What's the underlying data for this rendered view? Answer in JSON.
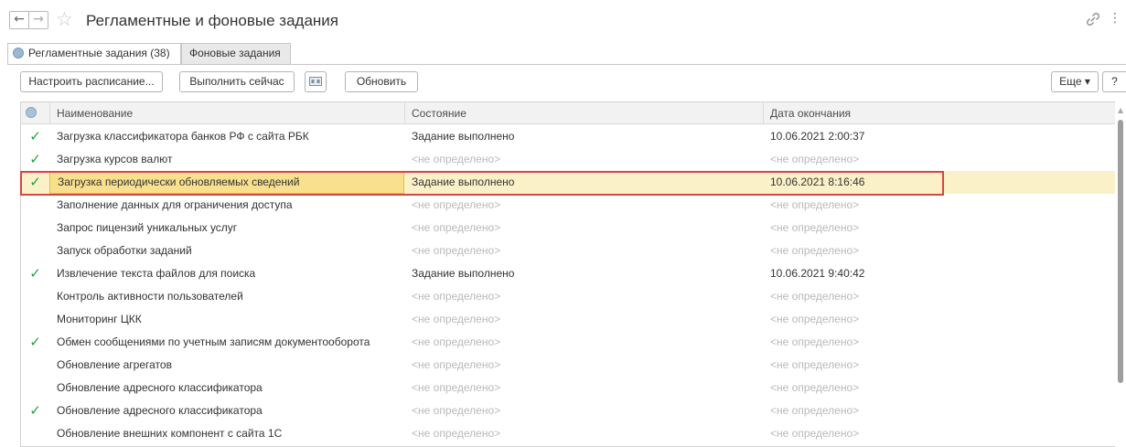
{
  "window": {
    "title": "Регламентные и фоновые задания",
    "back_glyph": "←",
    "forward_glyph": "→",
    "star_glyph": "☆",
    "more_glyph": "⋮"
  },
  "tabs": [
    {
      "label": "Регламентные задания (38)",
      "active": true
    },
    {
      "label": "Фоновые задания",
      "active": false
    }
  ],
  "toolbar": {
    "schedule_label": "Настроить расписание...",
    "run_now_label": "Выполнить сейчас",
    "refresh_label": "Обновить",
    "more_label": "Еще ▾",
    "help_label": "?"
  },
  "table": {
    "columns": [
      "Наименование",
      "Состояние",
      "Дата окончания"
    ],
    "check_glyph": "✓",
    "rows": [
      {
        "checked": true,
        "name": "Загрузка классификатора банков РФ с сайта РБК",
        "state": "Задание выполнено",
        "date": "10.06.2021 2:00:37"
      },
      {
        "checked": true,
        "name": "Загрузка курсов валют",
        "state": "<не определено>",
        "date": "<не определено>"
      },
      {
        "checked": true,
        "name": "Загрузка периодически обновляемых сведений",
        "state": "Задание выполнено",
        "date": "10.06.2021 8:16:46",
        "selected": true
      },
      {
        "checked": false,
        "name": "Заполнение данных для ограничения доступа",
        "state": "<не определено>",
        "date": "<не определено>"
      },
      {
        "checked": false,
        "name": "Запрос пицензий уникальных услуг",
        "state": "<не определено>",
        "date": "<не определено>"
      },
      {
        "checked": false,
        "name": "Запуск обработки заданий",
        "state": "<не определено>",
        "date": "<не определено>"
      },
      {
        "checked": true,
        "name": "Извлечение текста файлов для поиска",
        "state": "Задание выполнено",
        "date": "10.06.2021 9:40:42"
      },
      {
        "checked": false,
        "name": "Контроль активности пользователей",
        "state": "<не определено>",
        "date": "<не определено>"
      },
      {
        "checked": false,
        "name": "Мониторинг ЦКК",
        "state": "<не определено>",
        "date": "<не определено>"
      },
      {
        "checked": true,
        "name": "Обмен сообщениями по учетным записям документооборота",
        "state": "<не определено>",
        "date": "<не определено>"
      },
      {
        "checked": false,
        "name": "Обновление агрегатов",
        "state": "<не определено>",
        "date": "<не определено>"
      },
      {
        "checked": false,
        "name": "Обновление адресного классификатора",
        "state": "<не определено>",
        "date": "<не определено>"
      },
      {
        "checked": true,
        "name": "Обновление адресного классификатора",
        "state": "<не определено>",
        "date": "<не определено>"
      },
      {
        "checked": false,
        "name": "Обновление внешних компонент с сайта 1С",
        "state": "<не определено>",
        "date": "<не определено>"
      }
    ]
  },
  "colors": {
    "check": "#2a9d3f",
    "undefined_text": "#b9b9b9",
    "selected_row": "#fbf1c8",
    "selected_cell": "#f8e08e",
    "highlight_border": "#d94444"
  }
}
